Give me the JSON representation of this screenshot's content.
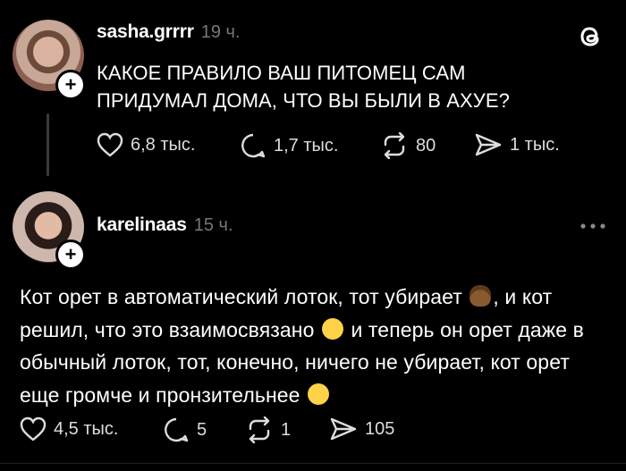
{
  "post1": {
    "username": "sasha.grrrr",
    "time": "19 ч.",
    "text": "КАКОЕ ПРАВИЛО ВАШ ПИТОМЕЦ САМ ПРИДУМАЛ ДОМА, ЧТО ВЫ БЫЛИ В АХУЕ?",
    "likes": "6,8 тыс.",
    "replies": "1,7 тыс.",
    "reposts": "80",
    "shares": "1 тыс."
  },
  "post2": {
    "username": "karelinaas",
    "time": "15 ч.",
    "text_part1": "Кот орет в автоматический лоток, тот убирает ",
    "text_part2": ", и кот решил, что это взаимосвязано ",
    "text_part3": " и теперь он орет даже в обычный лоток, тот, конечно, ничего не убирает, кот орет еще громче и пронзительнее ",
    "likes": "4,5 тыс.",
    "replies": "5",
    "reposts": "1",
    "shares": "105"
  },
  "plus_label": "+",
  "icons": {
    "app": "threads-logo-icon",
    "more": "more-icon",
    "emoji1": "poop-emoji",
    "emoji2": "tears-of-joy-emoji",
    "emoji3": "rolling-laughing-emoji"
  }
}
